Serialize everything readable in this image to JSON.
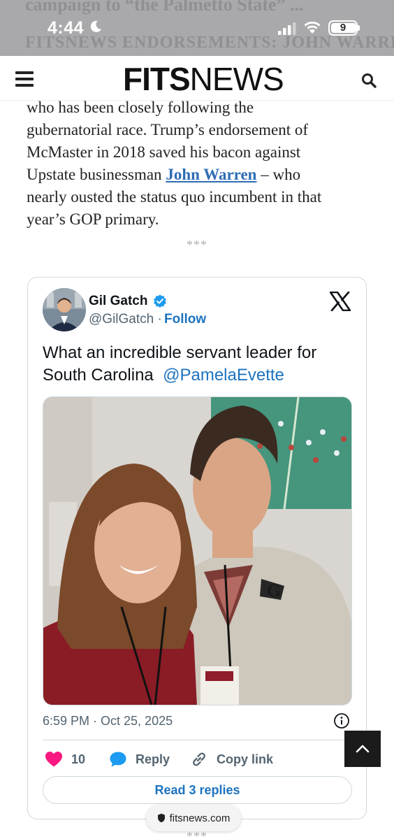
{
  "status_bar": {
    "time": "4:44",
    "battery_level": "9",
    "ghost_text_top": "campaign to “the Palmetto State” ...",
    "ghost_text_bottom": "FITSNEWS ENDORSEMENTS: JOHN WARREN IS ..."
  },
  "header": {
    "logo_bold": "FITS",
    "logo_light": "NEWS"
  },
  "article": {
    "line1": "who has been closely following the",
    "line2": "gubernatorial race. Trump’s endorsement of",
    "line3": "McMaster in 2018 saved his bacon against",
    "line4_before": "Upstate businessman ",
    "line4_link": "John Warren",
    "line4_after": " – who",
    "line5": "nearly ousted the status quo incumbent in that",
    "line6": "year’s GOP primary.",
    "separator": "***"
  },
  "tweet": {
    "author_name": "Gil Gatch",
    "handle": "@GilGatch",
    "dot": "·",
    "follow_label": "Follow",
    "text_line1": "What an incredible servant leader for",
    "text_line2_before": "South Carolina  ",
    "mention": "@PamelaEvette",
    "timestamp": "6:59 PM · Oct 25, 2025",
    "like_count": "10",
    "reply_label": "Reply",
    "copy_link_label": "Copy link",
    "read_replies_label": "Read 3 replies",
    "brand_color": "#1d9bf0",
    "like_color": "#f91880"
  },
  "browser": {
    "url": "fitsnews.com"
  },
  "footer": {
    "separator": "***"
  }
}
